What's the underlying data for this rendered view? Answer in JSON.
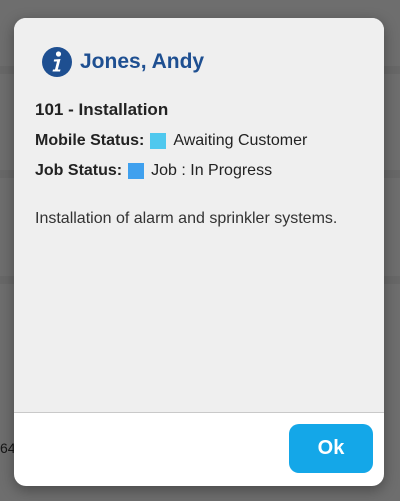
{
  "background": {
    "partial_text": "64"
  },
  "dialog": {
    "icon": "info-icon",
    "title": "Jones, Andy",
    "job_title": "101 - Installation",
    "mobile_status": {
      "label": "Mobile Status:",
      "value": "Awaiting Customer",
      "color": "#4fc8ee"
    },
    "job_status": {
      "label": "Job Status:",
      "value": "Job : In Progress",
      "color": "#3fa0ee"
    },
    "description": "Installation of alarm and sprinkler systems.",
    "ok_label": "Ok"
  },
  "colors": {
    "title": "#1e4f91",
    "ok_button": "#14a7e8"
  }
}
